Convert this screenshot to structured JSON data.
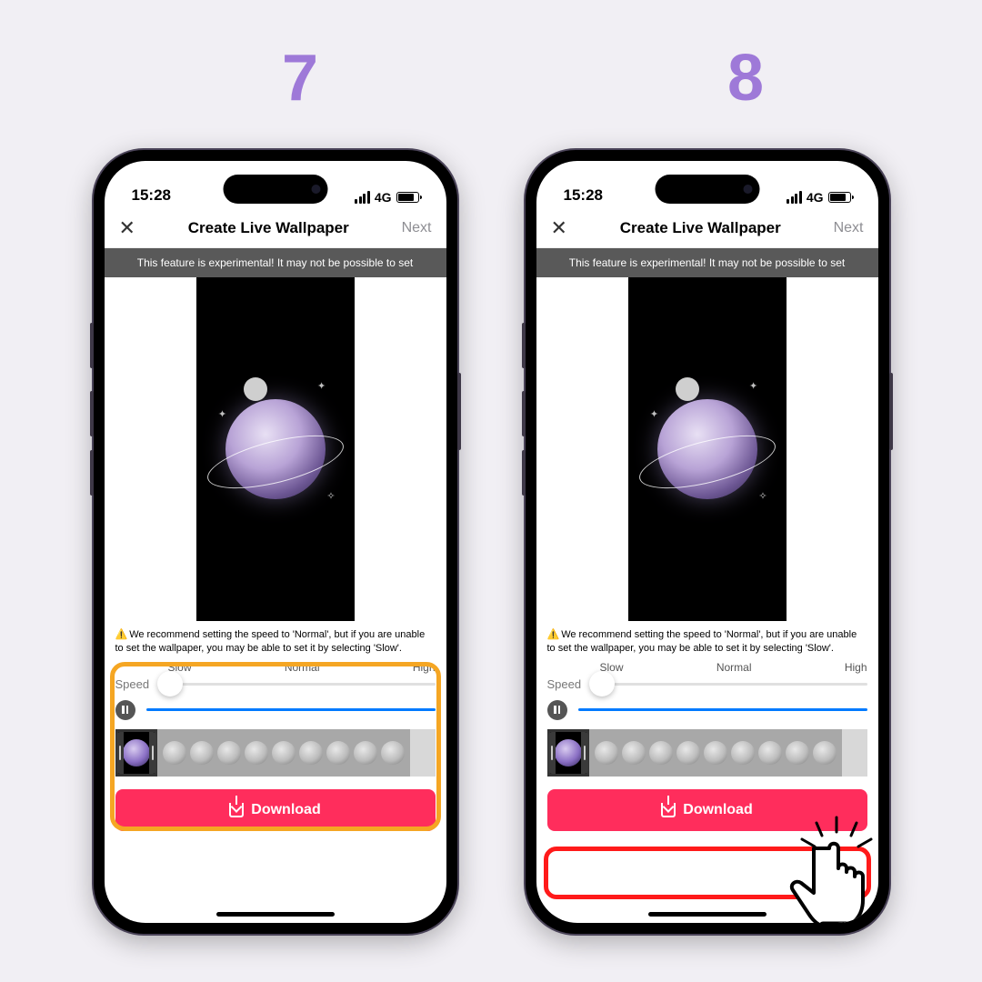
{
  "steps": {
    "left": "7",
    "right": "8"
  },
  "status": {
    "time": "15:28",
    "network": "4G"
  },
  "nav": {
    "title": "Create Live Wallpaper",
    "next": "Next"
  },
  "banner": "This feature is experimental! It may not be possible to set",
  "recommend": "We recommend setting the speed to 'Normal', but if you are unable to set the wallpaper, you may be able to set it by selecting 'Slow'.",
  "speed": {
    "label": "Speed",
    "options": {
      "slow": "Slow",
      "normal": "Normal",
      "high": "High"
    }
  },
  "download": "Download",
  "icons": {
    "warn": "⚠️"
  }
}
